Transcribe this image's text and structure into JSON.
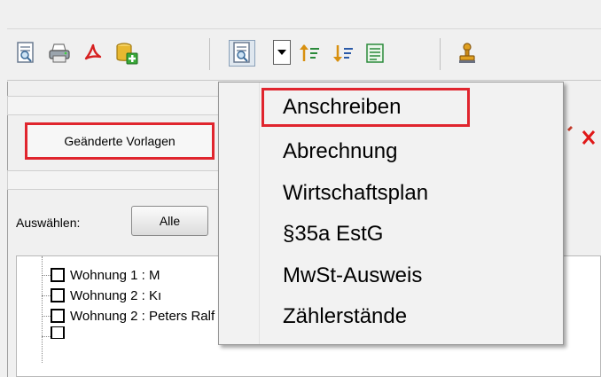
{
  "toolbar": {
    "icons": [
      "preview-icon",
      "printer-icon",
      "pdf-icon",
      "add-database-icon",
      "template-icon",
      "sort-ascending-icon",
      "sort-descending-icon",
      "list-icon",
      "stamp-icon"
    ]
  },
  "templates_button": {
    "label": "Geänderte Vorlagen"
  },
  "select": {
    "label": "Auswählen:",
    "all_button": "Alle"
  },
  "tree": {
    "items": [
      {
        "label": "Wohnung 1 : M"
      },
      {
        "label": "Wohnung 2 : Kı"
      },
      {
        "label": "Wohnung 2 : Peters Ralf"
      }
    ]
  },
  "menu": {
    "items": [
      {
        "label": "Anschreiben",
        "highlighted": true
      },
      {
        "label": "Abrechnung"
      },
      {
        "label": "Wirtschaftsplan"
      },
      {
        "label": "§35a EstG"
      },
      {
        "label": "MwSt-Ausweis"
      },
      {
        "label": "Zählerstände"
      }
    ]
  },
  "colors": {
    "highlight": "#e0252e",
    "menu_bg": "#f2f2f2"
  }
}
